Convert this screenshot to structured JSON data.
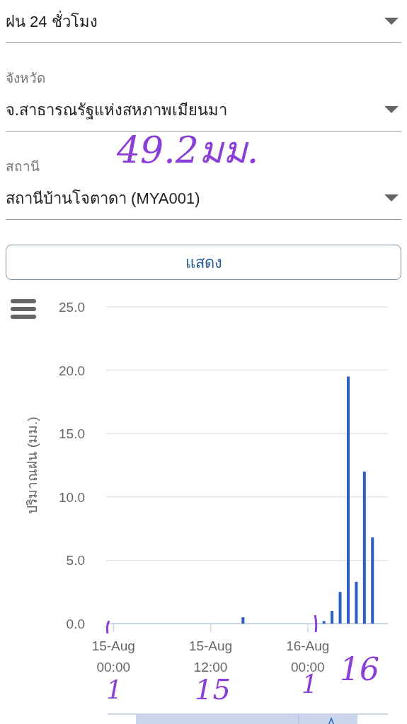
{
  "filters": [
    {
      "value": "ฝน 24 ชั่วโมง"
    },
    {
      "label": "จังหวัด",
      "value": "จ.สาธารณรัฐแห่งสหภาพเมียนมา"
    },
    {
      "label": "สถานี",
      "value": "สถานีบ้านโจตาดา (MYA001)"
    }
  ],
  "show_button": "แสดง",
  "chart": {
    "chart_data": {
      "type": "bar",
      "ylabel": "ปริมาณฝน (มม.)",
      "categories": [
        "15-Aug 00:00",
        null,
        null,
        null,
        null,
        null,
        null,
        null,
        null,
        null,
        null,
        null,
        "15-Aug 12:00",
        null,
        null,
        null,
        null,
        null,
        null,
        null,
        null,
        null,
        null,
        null,
        "16-Aug 00:00",
        null,
        null,
        null,
        null,
        null,
        null,
        null,
        null,
        null
      ],
      "series": [
        {
          "color": "#2b5fc1",
          "values": [
            null,
            null,
            null,
            null,
            null,
            null,
            null,
            null,
            null,
            null,
            null,
            null,
            null,
            null,
            null,
            null,
            0.5,
            null,
            null,
            null,
            null,
            null,
            null,
            null,
            null,
            null,
            0.2,
            1.0,
            2.5,
            19.5,
            3.3,
            12.0,
            6.8,
            null
          ]
        }
      ],
      "ylim": [
        0,
        25
      ],
      "grid": true,
      "yticks": [
        {
          "value": 0,
          "label": "0.0"
        },
        {
          "value": 5,
          "label": "5.0"
        },
        {
          "value": 10,
          "label": "10.0"
        },
        {
          "value": 15,
          "label": "15.0"
        },
        {
          "value": 20,
          "label": "20.0"
        },
        {
          "value": 25,
          "label": "25.0"
        }
      ]
    }
  },
  "annotations": [
    {
      "kind": "handwriting",
      "text": "49.2มม."
    },
    {
      "kind": "handwriting",
      "text": "1"
    },
    {
      "kind": "handwriting",
      "text": "15"
    },
    {
      "kind": "handwriting",
      "text": "1"
    },
    {
      "kind": "handwriting",
      "text": "16"
    }
  ]
}
